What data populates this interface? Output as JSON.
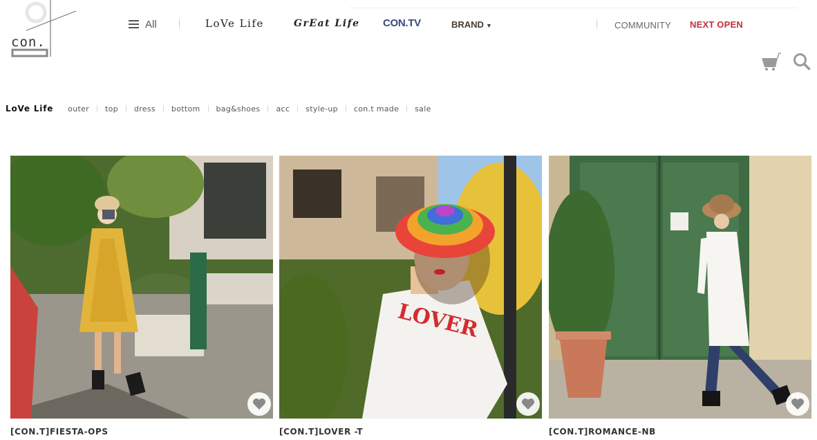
{
  "brand": {
    "logo_text": "con."
  },
  "nav": {
    "all_label": "All",
    "items": [
      "LoVe Life",
      "GrEat Life",
      "CON.TV",
      "BRAND"
    ],
    "right_items": [
      "COMMUNITY",
      "NEXT OPEN"
    ],
    "cart_icon": "cart-icon",
    "search_icon": "search-icon"
  },
  "subnav": {
    "title": "LoVe Life",
    "items": [
      "outer",
      "top",
      "dress",
      "bottom",
      "bag&shoes",
      "acc",
      "style-up",
      "con.t made",
      "sale"
    ]
  },
  "products": [
    {
      "name": "[CON.T]FIESTA-OPS",
      "image": "woman in yellow floral dress holding camera, garden street",
      "wish_icon": "heart-icon"
    },
    {
      "name": "[CON.T]LOVER -T",
      "image": "woman in rainbow crochet bucket hat and white LOVER t-shirt",
      "print": "LOVER",
      "wish_icon": "heart-icon"
    },
    {
      "name": "[CON.T]ROMANCE-NB",
      "image": "woman in white long shirt and bucket hat in front of green door",
      "wish_icon": "heart-icon"
    }
  ],
  "colors": {
    "accent_red": "#c0303b",
    "contv_blue": "#3a4a7c",
    "brand_brown": "#4b3b2f",
    "icon_gray": "#9a9a9a"
  }
}
